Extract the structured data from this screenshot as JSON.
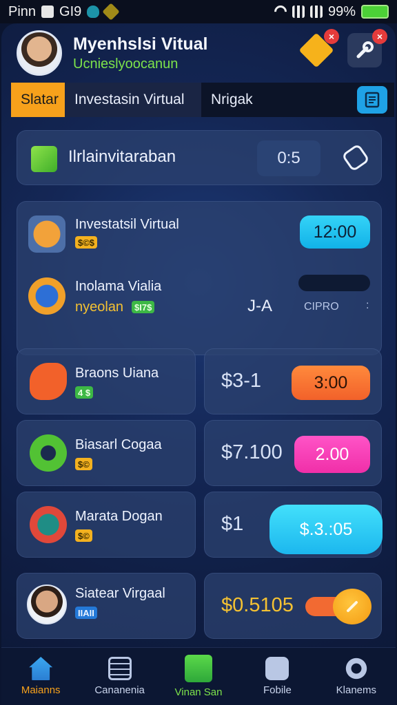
{
  "status": {
    "left_text": "Pinn",
    "carrier": "GI9",
    "battery": "99%"
  },
  "header": {
    "title": "Myenhslsi Vitual",
    "subtitle": "Ucnieslyoocanun"
  },
  "tabs": [
    {
      "label": "Slatar",
      "active": true
    },
    {
      "label": "Investasin Virtual",
      "active": false
    },
    {
      "label": "Nrigak",
      "active": false
    }
  ],
  "title_card": {
    "label": "Ilrlainvitaraban",
    "timer": "0:5"
  },
  "big_card": {
    "rows": [
      {
        "title": "Investatsil Virtual",
        "chip": "$©$",
        "pill": "12:00",
        "icon": "house-gear-icon"
      },
      {
        "title": "Inolama Vialia",
        "subtitle": "nyeolan",
        "chip": "$I7$",
        "value": "J-A",
        "small": "CIPRO",
        "icon": "compass-icon"
      }
    ]
  },
  "list": [
    {
      "title": "Braons Uiana",
      "chip": "4 $",
      "price": "$3-1",
      "pill": "3:00",
      "icon": "chat-burst-icon",
      "pill_color": "orange"
    },
    {
      "title": "Biasarl Cogaa",
      "chip": "$©",
      "price": "$7.100",
      "pill": "2.00",
      "icon": "gear-icon",
      "pill_color": "pink"
    },
    {
      "title": "Marata Dogan",
      "chip": "$©",
      "price": "$1",
      "pill": "$.3.:05",
      "icon": "tool-badge-icon",
      "pill_color": "cyan"
    },
    {
      "title": "Siatear Virgaal",
      "chip": "IIAII",
      "price": "$0.5105",
      "icon": "avatar"
    }
  ],
  "nav": [
    {
      "label": "Maianns",
      "icon": "home-icon",
      "active": true
    },
    {
      "label": "Cananenia",
      "icon": "chart-icon",
      "active": false
    },
    {
      "label": "Vinan San",
      "icon": "document-icon",
      "active": false
    },
    {
      "label": "Fobile",
      "icon": "wallet-icon",
      "active": false
    },
    {
      "label": "Klanems",
      "icon": "settings-icon",
      "active": false
    }
  ],
  "colors": {
    "accent": "#f7a11b",
    "green": "#7de34b",
    "cyan": "#1cb7ee",
    "pink": "#f02fa8",
    "orange": "#f2612a"
  }
}
